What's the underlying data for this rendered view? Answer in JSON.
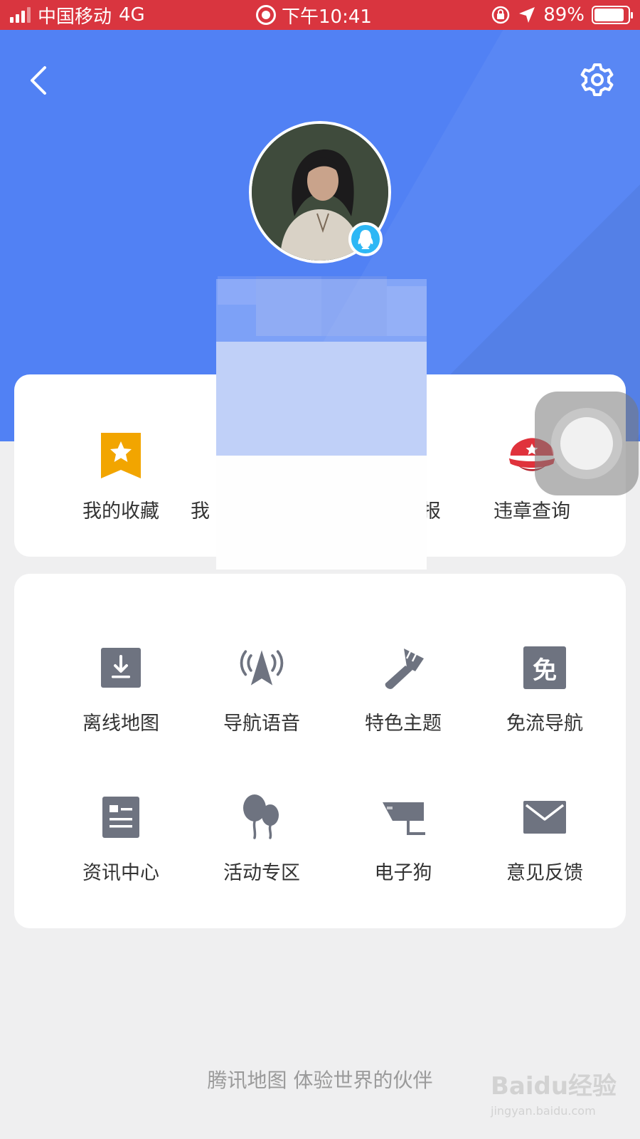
{
  "status_bar": {
    "carrier": "中国移动",
    "network": "4G",
    "time": "下午10:41",
    "battery": "89%",
    "battery_level": 0.89
  },
  "header": {
    "back_icon": "chevron-left-icon",
    "settings_icon": "gear-icon"
  },
  "quick_actions": [
    {
      "label": "我的收藏",
      "icon": "star-bookmark-icon",
      "color": "#f2a500"
    },
    {
      "label": "违章查询",
      "icon": "police-cap-icon",
      "color": "#e0323c"
    }
  ],
  "quick_actions_partial": {
    "left_fragment": "我",
    "right_fragment": "报"
  },
  "tools": [
    {
      "label": "离线地图",
      "icon": "download-icon"
    },
    {
      "label": "导航语音",
      "icon": "navigation-voice-icon"
    },
    {
      "label": "特色主题",
      "icon": "paintbrush-icon"
    },
    {
      "label": "免流导航",
      "icon": "free-data-icon",
      "glyph": "免"
    },
    {
      "label": "资讯中心",
      "icon": "news-icon"
    },
    {
      "label": "活动专区",
      "icon": "balloons-icon"
    },
    {
      "label": "电子狗",
      "icon": "camera-icon"
    },
    {
      "label": "意见反馈",
      "icon": "envelope-icon"
    }
  ],
  "footer": {
    "slogan": "腾讯地图 体验世界的伙伴"
  },
  "watermark": {
    "title": "Baidu经验",
    "subtitle": "jingyan.baidu.com"
  },
  "colors": {
    "status_bar": "#d9353f",
    "header": "#5181f4",
    "icon_gray": "#6e7380",
    "qq_badge": "#2db7f5"
  }
}
